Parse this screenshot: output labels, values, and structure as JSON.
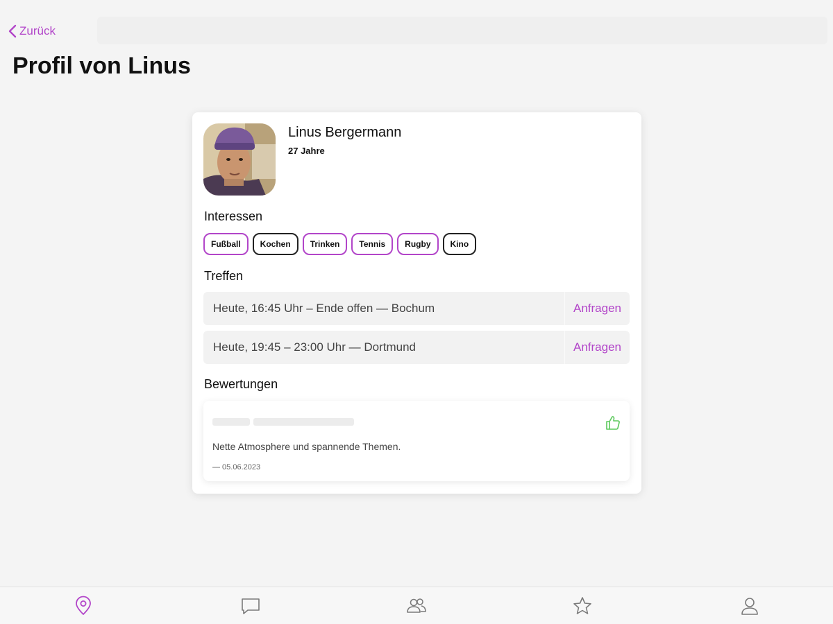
{
  "nav": {
    "back_label": "Zurück"
  },
  "page": {
    "title": "Profil von Linus"
  },
  "profile": {
    "name": "Linus Bergermann",
    "age": "27 Jahre"
  },
  "interests": {
    "label": "Interessen",
    "tags": [
      "Fußball",
      "Kochen",
      "Trinken",
      "Tennis",
      "Rugby",
      "Kino"
    ]
  },
  "meetings": {
    "label": "Treffen",
    "items": [
      {
        "text": "Heute, 16:45 Uhr – Ende offen — Bochum",
        "action": "Anfragen"
      },
      {
        "text": "Heute, 19:45 – 23:00 Uhr — Dortmund",
        "action": "Anfragen"
      }
    ]
  },
  "reviews": {
    "label": "Bewertungen",
    "items": [
      {
        "text": "Nette Atmosphere und spannende Themen.",
        "date": "— 05.06.2023",
        "icon": "thumbs-up-icon"
      }
    ]
  },
  "tabbar": {
    "icons": [
      "map-pin-icon",
      "chat-icon",
      "people-icon",
      "star-icon",
      "person-icon"
    ]
  },
  "colors": {
    "accent": "#b245c9",
    "positive": "#5cc95c",
    "background": "#f4f4f4"
  }
}
